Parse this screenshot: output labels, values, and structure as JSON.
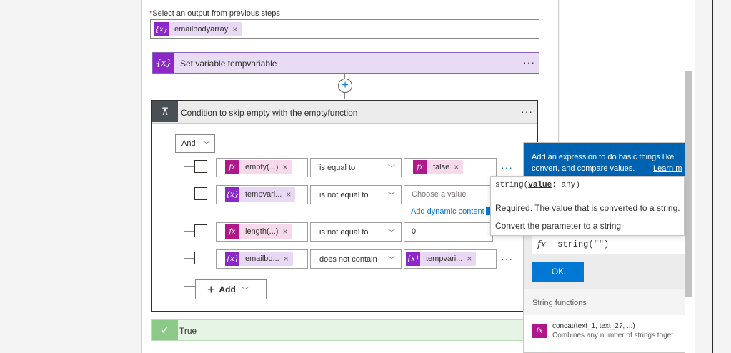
{
  "output_selector": {
    "required_mark": "*",
    "label": "Select an output from previous steps",
    "token": {
      "icon": "variable-icon",
      "text": "emailbodyarray"
    }
  },
  "set_variable": {
    "title": "Set variable tempvariable",
    "more": "···"
  },
  "insert_step": {
    "icon": "plus-icon"
  },
  "condition": {
    "title": "Condition to skip empty with the emptyfunction",
    "more": "···",
    "group_operator": "And",
    "rows": [
      {
        "left": {
          "kind": "fx",
          "text": "empty(...)"
        },
        "operator": "is equal to",
        "right": {
          "kind": "fx",
          "text": "false"
        },
        "more": "···"
      },
      {
        "left": {
          "kind": "var",
          "text": "tempvari..."
        },
        "operator": "is not equal to",
        "right": {
          "kind": "placeholder",
          "text": "Choose a value"
        },
        "dynamic_link": "Add dynamic content"
      },
      {
        "left": {
          "kind": "fx",
          "text": "length(...)"
        },
        "operator": "is not equal to",
        "right": {
          "kind": "text",
          "text": "0"
        }
      },
      {
        "left": {
          "kind": "var",
          "text": "emailbo..."
        },
        "operator": "does not contain",
        "right": {
          "kind": "var",
          "text": "tempvari..."
        },
        "more": "···"
      }
    ],
    "add_label": "Add"
  },
  "true_branch": {
    "label": "True"
  },
  "expression_panel": {
    "info_text": "Add an expression to do basic things like convert, and compare values.",
    "learn_more": "Learn m",
    "expression": "string(\"\")",
    "ok_label": "OK",
    "section_title": "String functions",
    "functions": [
      {
        "name": "concat(text_1, text_2?, ...)",
        "desc": "Combines any number of strings toget"
      }
    ]
  },
  "tooltip": {
    "signature_fn": "string(",
    "signature_param": "value",
    "signature_rest": ": any)",
    "param_desc": "Required. The value that is converted to a string.",
    "fn_desc": "Convert the parameter to a string"
  },
  "colors": {
    "variable_purple": "#8c28c8",
    "function_magenta": "#b0178a",
    "accent_blue": "#0078d4",
    "panel_blue": "#0063b1",
    "true_green": "#8cc888"
  }
}
